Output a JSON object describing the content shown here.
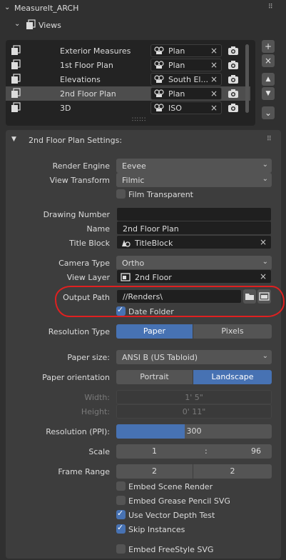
{
  "header": {
    "title": "MeasureIt_ARCH",
    "views_label": "Views"
  },
  "views_list": [
    {
      "name": "Exterior Measures",
      "camera": "Plan",
      "selected": false
    },
    {
      "name": "1st Floor Plan",
      "camera": "Plan",
      "selected": false
    },
    {
      "name": "Elevations",
      "camera": "South El...",
      "selected": false
    },
    {
      "name": "2nd Floor Plan",
      "camera": "Plan",
      "selected": true
    },
    {
      "name": "3D",
      "camera": "ISO",
      "selected": false
    }
  ],
  "side_buttons": {
    "add": "+",
    "remove": "×",
    "up": "▲",
    "down": "▼",
    "menu": "⌄"
  },
  "settings": {
    "title": "2nd Floor Plan Settings:",
    "render_engine": {
      "label": "Render Engine",
      "value": "Eevee"
    },
    "view_transform": {
      "label": "View Transform",
      "value": "Filmic"
    },
    "film_transparent": {
      "label": "Film Transparent",
      "checked": false
    },
    "drawing_number": {
      "label": "Drawing Number",
      "value": ""
    },
    "name": {
      "label": "Name",
      "value": "2nd Floor Plan"
    },
    "title_block": {
      "label": "Title Block",
      "value": "TitleBlock"
    },
    "camera_type": {
      "label": "Camera Type",
      "value": "Ortho"
    },
    "view_layer": {
      "label": "View Layer",
      "value": "2nd Floor"
    },
    "output_path": {
      "label": "Output Path",
      "value": "//Renders\\"
    },
    "date_folder": {
      "label": "Date Folder",
      "checked": true
    },
    "resolution_type": {
      "label": "Resolution Type",
      "options": [
        "Paper",
        "Pixels"
      ],
      "selected": "Paper"
    },
    "paper_size": {
      "label": "Paper size:",
      "value": "ANSI B (US Tabloid)"
    },
    "paper_orientation": {
      "label": "Paper orientation",
      "options": [
        "Portrait",
        "Landscape"
      ],
      "selected": "Landscape"
    },
    "width": {
      "label": "Width:",
      "value": "1' 5\""
    },
    "height": {
      "label": "Height:",
      "value": "0' 11\""
    },
    "resolution_ppi": {
      "label": "Resolution (PPI):",
      "value": "300",
      "fill": 0.44
    },
    "scale": {
      "label": "Scale",
      "left": "1",
      "sep": ":",
      "right": "96"
    },
    "frame_range": {
      "label": "Frame Range",
      "start": "2",
      "end": "2"
    },
    "checkboxes": [
      {
        "label": "Embed Scene Render",
        "checked": false
      },
      {
        "label": "Embed Grease Pencil SVG",
        "checked": false
      },
      {
        "label": "Use Vector Depth Test",
        "checked": true
      },
      {
        "label": "Skip Instances",
        "checked": true
      },
      {
        "label": "Embed FreeStyle SVG",
        "checked": false
      }
    ]
  },
  "colors": {
    "accent": "#4772b3",
    "annotation": "#e02020"
  }
}
